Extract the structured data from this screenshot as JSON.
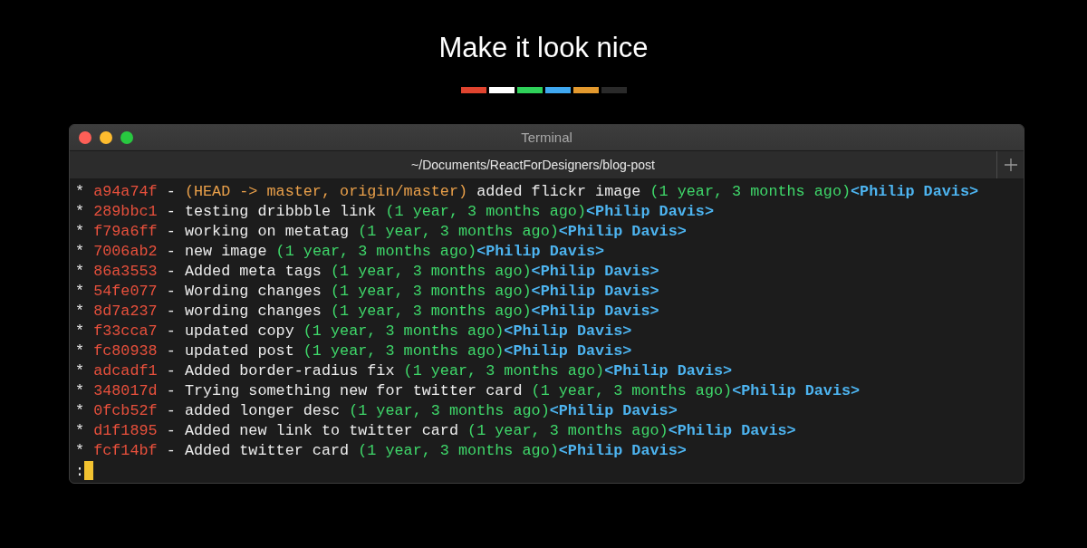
{
  "heading": "Make it look nice",
  "color_strip": [
    {
      "color": "#e0442f"
    },
    {
      "color": "#ffffff"
    },
    {
      "color": "#2fd15a"
    },
    {
      "color": "#3fa8f0"
    },
    {
      "color": "#e3992e"
    },
    {
      "color": "#2a2a2a"
    }
  ],
  "window": {
    "title": "Terminal",
    "tab": "~/Documents/ReactForDesigners/blog-post"
  },
  "log_lines": [
    {
      "bullet": "*",
      "hash": "a94a74f",
      "separator": "-",
      "refs": "(HEAD -> master, origin/master)",
      "message": "added flickr image",
      "date": "(1 year, 3 months ago)",
      "author": "<Philip Davis>"
    },
    {
      "bullet": "*",
      "hash": "289bbc1",
      "separator": "-",
      "message": "testing dribbble link",
      "date": "(1 year, 3 months ago)",
      "author": "<Philip Davis>"
    },
    {
      "bullet": "*",
      "hash": "f79a6ff",
      "separator": "-",
      "message": "working on metatag",
      "date": "(1 year, 3 months ago)",
      "author": "<Philip Davis>"
    },
    {
      "bullet": "*",
      "hash": "7006ab2",
      "separator": "-",
      "message": "new image",
      "date": "(1 year, 3 months ago)",
      "author": "<Philip Davis>"
    },
    {
      "bullet": "*",
      "hash": "86a3553",
      "separator": "-",
      "message": "Added meta tags",
      "date": "(1 year, 3 months ago)",
      "author": "<Philip Davis>"
    },
    {
      "bullet": "*",
      "hash": "54fe077",
      "separator": "-",
      "message": "Wording changes",
      "date": "(1 year, 3 months ago)",
      "author": "<Philip Davis>"
    },
    {
      "bullet": "*",
      "hash": "8d7a237",
      "separator": "-",
      "message": "wording changes",
      "date": "(1 year, 3 months ago)",
      "author": "<Philip Davis>"
    },
    {
      "bullet": "*",
      "hash": "f33cca7",
      "separator": "-",
      "message": "updated copy",
      "date": "(1 year, 3 months ago)",
      "author": "<Philip Davis>"
    },
    {
      "bullet": "*",
      "hash": "fc80938",
      "separator": "-",
      "message": "updated post",
      "date": "(1 year, 3 months ago)",
      "author": "<Philip Davis>"
    },
    {
      "bullet": "*",
      "hash": "adcadf1",
      "separator": "-",
      "message": "Added border-radius fix",
      "date": "(1 year, 3 months ago)",
      "author": "<Philip Davis>"
    },
    {
      "bullet": "*",
      "hash": "348017d",
      "separator": "-",
      "message": "Trying something new for twitter card",
      "date": "(1 year, 3 months ago)",
      "author": "<Philip Davis>"
    },
    {
      "bullet": "*",
      "hash": "0fcb52f",
      "separator": "-",
      "message": "added longer desc",
      "date": "(1 year, 3 months ago)",
      "author": "<Philip Davis>"
    },
    {
      "bullet": "*",
      "hash": "d1f1895",
      "separator": "-",
      "message": "Added new link to twitter card",
      "date": "(1 year, 3 months ago)",
      "author": "<Philip Davis>"
    },
    {
      "bullet": "*",
      "hash": "fcf14bf",
      "separator": "-",
      "message": "Added twitter card",
      "date": "(1 year, 3 months ago)",
      "author": "<Philip Davis>"
    }
  ],
  "prompt": ":"
}
